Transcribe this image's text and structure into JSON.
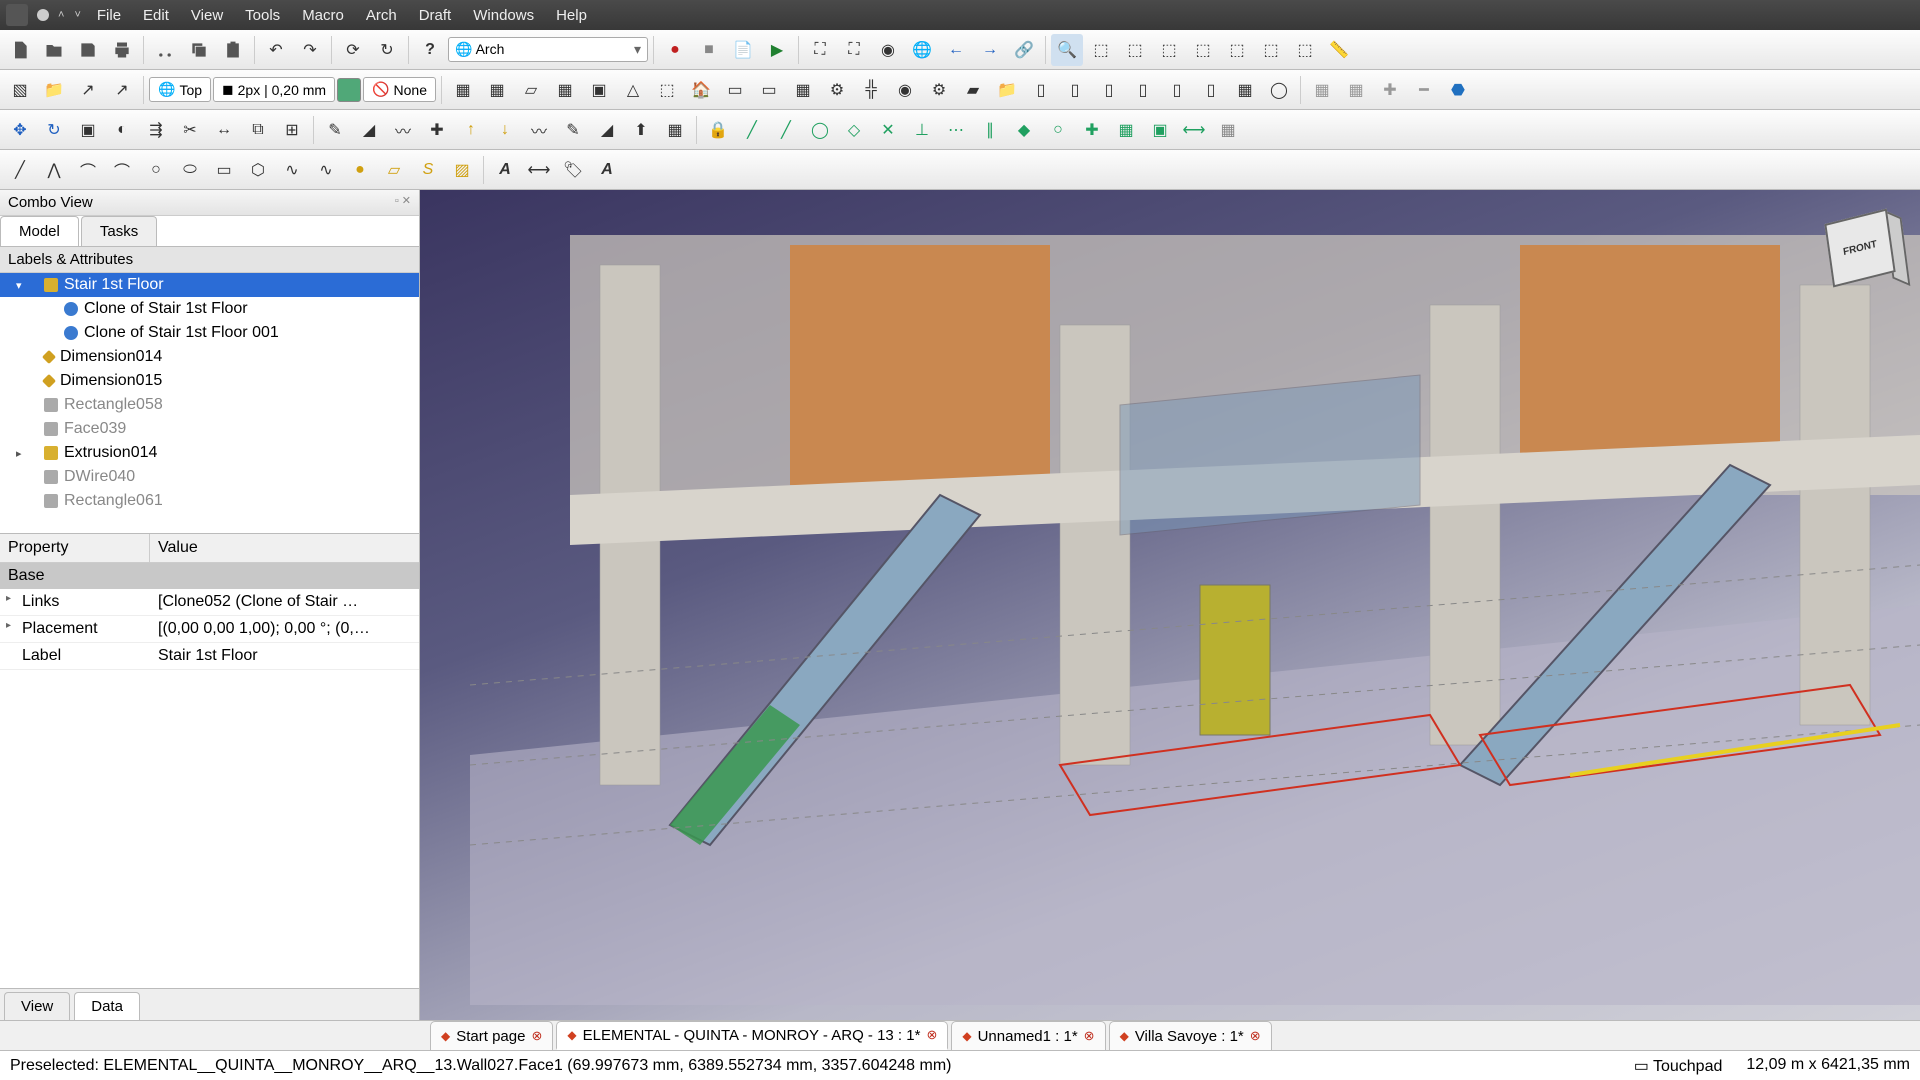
{
  "menu": {
    "items": [
      "File",
      "Edit",
      "View",
      "Tools",
      "Macro",
      "Arch",
      "Draft",
      "Windows",
      "Help"
    ]
  },
  "workbench": "Arch",
  "toolbar2": {
    "view": "Top",
    "linewidth": "2px | 0,20 mm",
    "style": "None"
  },
  "combo": {
    "title": "Combo View",
    "tabs": [
      "Model",
      "Tasks"
    ],
    "section": "Labels & Attributes",
    "tree": [
      {
        "label": "Stair 1st Floor",
        "selected": true,
        "expander": "▾",
        "icon": "cube"
      },
      {
        "label": "Clone of Stair 1st Floor",
        "icon": "blue",
        "indent": 1
      },
      {
        "label": "Clone of Stair 1st Floor 001",
        "icon": "blue",
        "indent": 1
      },
      {
        "label": "Dimension014",
        "icon": "dim"
      },
      {
        "label": "Dimension015",
        "icon": "dim"
      },
      {
        "label": "Rectangle058",
        "icon": "gray"
      },
      {
        "label": "Face039",
        "icon": "gray"
      },
      {
        "label": "Extrusion014",
        "icon": "cube",
        "expander": "▸"
      },
      {
        "label": "DWire040",
        "icon": "gray"
      },
      {
        "label": "Rectangle061",
        "icon": "gray"
      }
    ],
    "props": {
      "headers": [
        "Property",
        "Value"
      ],
      "group": "Base",
      "rows": [
        {
          "name": "Links",
          "value": "[Clone052 (Clone of Stair …",
          "exp": "▸"
        },
        {
          "name": "Placement",
          "value": "[(0,00 0,00 1,00); 0,00 °; (0,…",
          "exp": "▸"
        },
        {
          "name": "Label",
          "value": "Stair 1st Floor"
        }
      ]
    },
    "bottom_tabs": [
      "View",
      "Data"
    ]
  },
  "doc_tabs": [
    {
      "label": "Start page",
      "active": false
    },
    {
      "label": "ELEMENTAL - QUINTA - MONROY - ARQ - 13 : 1*",
      "active": true
    },
    {
      "label": "Unnamed1 : 1*",
      "active": false
    },
    {
      "label": "Villa Savoye : 1*",
      "active": false
    }
  ],
  "status": {
    "left": "Preselected: ELEMENTAL__QUINTA__MONROY__ARQ__13.Wall027.Face1 (69.997673 mm, 6389.552734 mm, 3357.604248 mm)",
    "nav": "Touchpad",
    "dim": "12,09 m x 6421,35 mm"
  },
  "navcube": {
    "face": "FRONT"
  }
}
